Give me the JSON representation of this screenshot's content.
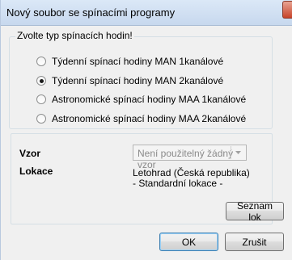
{
  "window": {
    "title": "Nový soubor se spínacími programy"
  },
  "group": {
    "legend": "Zvolte typ spínacích hodin!",
    "options": [
      {
        "label": "Týdenní spínací hodiny MAN 1kanálové",
        "selected": false
      },
      {
        "label": "Týdenní spínací hodiny MAN 2kanálové",
        "selected": true
      },
      {
        "label": "Astronomické spínací hodiny MAA 1kanálové",
        "selected": false
      },
      {
        "label": "Astronomické spínací hodiny MAA 2kanálové",
        "selected": false
      }
    ]
  },
  "vzor": {
    "label": "Vzor",
    "value": "Není použitelný žádný vzor",
    "disabled": true
  },
  "lokace": {
    "label": "Lokace",
    "line1": "Letohrad (Česká republika)",
    "line2": "- Standardní lokace -"
  },
  "buttons": {
    "locations": "Seznam lok",
    "ok": "OK",
    "cancel": "Zrušit"
  }
}
